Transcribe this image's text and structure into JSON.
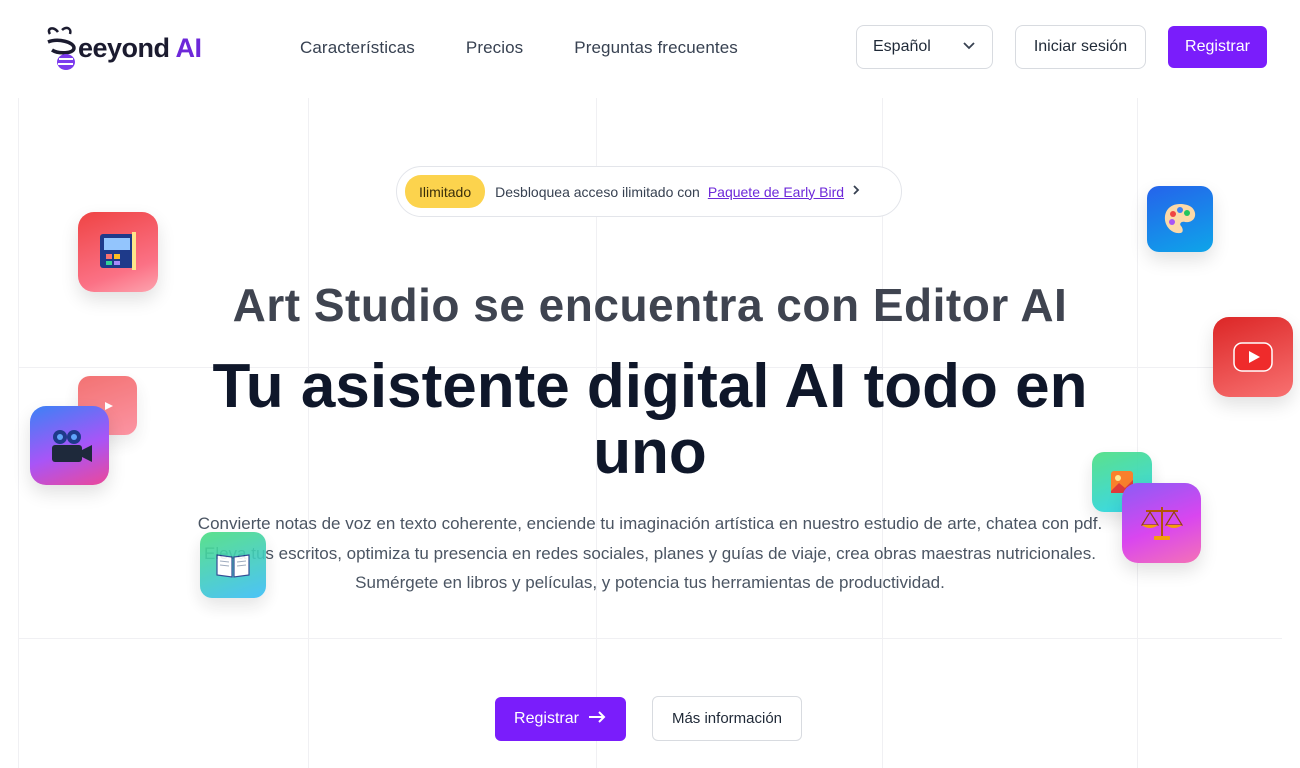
{
  "brand": {
    "name_part": "eeyond",
    "name_ai": "AI",
    "accent": "#7a1dfb"
  },
  "nav": {
    "items": [
      {
        "label": "Características"
      },
      {
        "label": "Precios"
      },
      {
        "label": "Preguntas frecuentes"
      }
    ]
  },
  "header": {
    "language_value": "Español",
    "login_label": "Iniciar sesión",
    "register_label": "Registrar"
  },
  "promo": {
    "badge": "Ilimitado",
    "text": "Desbloquea acceso ilimitado con",
    "link": "Paquete de Early Bird"
  },
  "hero": {
    "subtitle": "Art Studio se encuentra con Editor AI",
    "title": "Tu asistente digital AI todo en uno",
    "description_lines": [
      "Convierte notas de voz en texto coherente, enciende tu imaginación artística en nuestro estudio de arte, chatea con pdf.",
      "Eleva tus escritos, optimiza tu presencia en redes sociales, planes y guías de viaje, crea obras maestras nutricionales.",
      "Sumérgete en libros y películas, y potencia tus herramientas de productividad."
    ],
    "cta_primary": "Registrar",
    "cta_secondary": "Más información"
  },
  "floating_icons": [
    "art-studio-icon",
    "palette-icon",
    "youtube-icon",
    "youtube-small-icon",
    "video-camera-icon",
    "image-icon",
    "scale-icon",
    "book-icon"
  ]
}
